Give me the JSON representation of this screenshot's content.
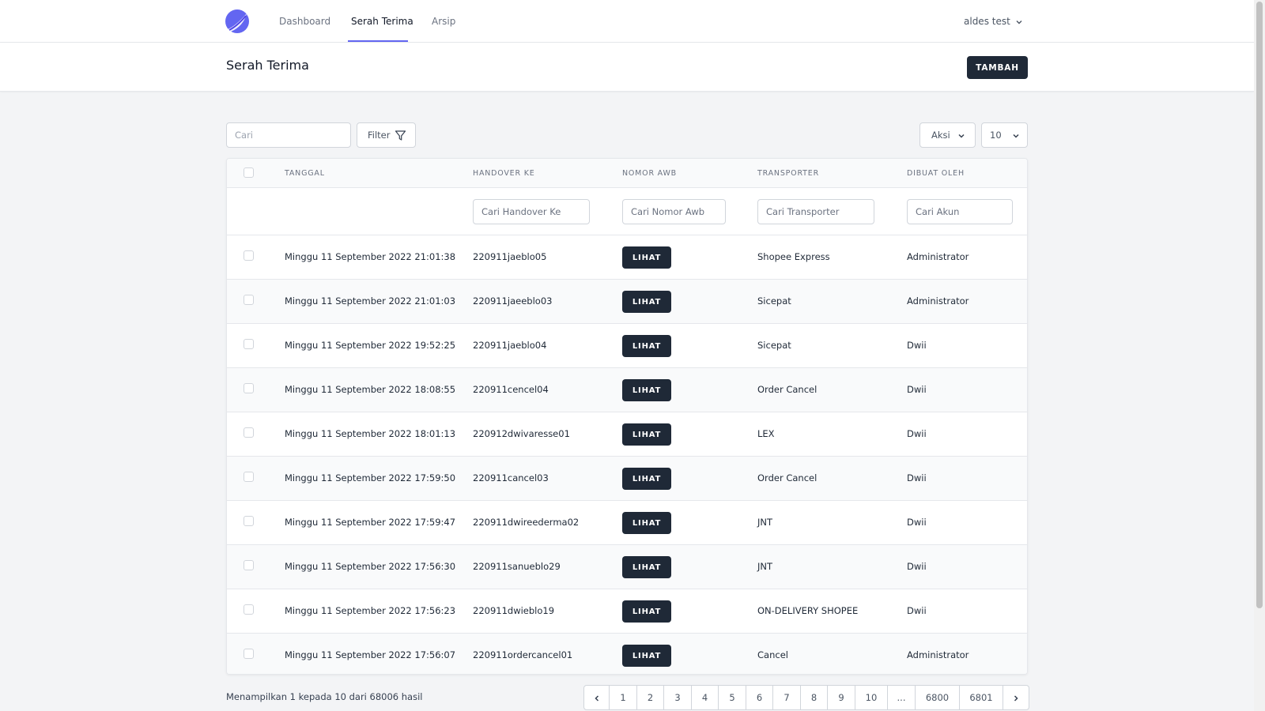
{
  "nav": {
    "logo_icon": "brand-logo",
    "links": [
      {
        "label": "Dashboard"
      },
      {
        "label": "Serah Terima",
        "active": true
      },
      {
        "label": "Arsip"
      }
    ],
    "user": "aldes test",
    "accent": "#6366f1"
  },
  "header": {
    "title": "Serah Terima",
    "add_button": "TAMBAH"
  },
  "toolbar": {
    "search_placeholder": "Cari",
    "filter_label": "Filter",
    "aksi_label": "Aksi",
    "per_page": "10"
  },
  "table": {
    "columns": [
      "TANGGAL",
      "HANDOVER KE",
      "NOMOR AWB",
      "TRANSPORTER",
      "DIBUAT OLEH"
    ],
    "filters": {
      "handover_placeholder": "Cari Handover Ke",
      "awb_placeholder": "Cari Nomor Awb",
      "transporter_placeholder": "Cari Transporter",
      "akun_placeholder": "Cari Akun"
    },
    "view_label": "LIHAT",
    "rows": [
      {
        "tanggal": "Minggu 11 September 2022 21:01:38",
        "handover": "220911jaeblo05",
        "transporter": "Shopee Express",
        "dibuat_oleh": "Administrator"
      },
      {
        "tanggal": "Minggu 11 September 2022 21:01:03",
        "handover": "220911jaeeblo03",
        "transporter": "Sicepat",
        "dibuat_oleh": "Administrator"
      },
      {
        "tanggal": "Minggu 11 September 2022 19:52:25",
        "handover": "220911jaeblo04",
        "transporter": "Sicepat",
        "dibuat_oleh": "Dwii"
      },
      {
        "tanggal": "Minggu 11 September 2022 18:08:55",
        "handover": "220911cencel04",
        "transporter": "Order Cancel",
        "dibuat_oleh": "Dwii"
      },
      {
        "tanggal": "Minggu 11 September 2022 18:01:13",
        "handover": "220912dwivaresse01",
        "transporter": "LEX",
        "dibuat_oleh": "Dwii"
      },
      {
        "tanggal": "Minggu 11 September 2022 17:59:50",
        "handover": "220911cancel03",
        "transporter": "Order Cancel",
        "dibuat_oleh": "Dwii"
      },
      {
        "tanggal": "Minggu 11 September 2022 17:59:47",
        "handover": "220911dwireederma02",
        "transporter": "JNT",
        "dibuat_oleh": "Dwii"
      },
      {
        "tanggal": "Minggu 11 September 2022 17:56:30",
        "handover": "220911sanueblo29",
        "transporter": "JNT",
        "dibuat_oleh": "Dwii"
      },
      {
        "tanggal": "Minggu 11 September 2022 17:56:23",
        "handover": "220911dwieblo19",
        "transporter": "ON-DELIVERY SHOPEE",
        "dibuat_oleh": "Dwii"
      },
      {
        "tanggal": "Minggu 11 September 2022 17:56:07",
        "handover": "220911ordercancel01",
        "transporter": "Cancel",
        "dibuat_oleh": "Administrator"
      }
    ]
  },
  "footer": {
    "summary": "Menampilkan 1 kepada 10 dari 68006 hasil",
    "pages": [
      "1",
      "2",
      "3",
      "4",
      "5",
      "6",
      "7",
      "8",
      "9",
      "10",
      "...",
      "6800",
      "6801"
    ]
  }
}
